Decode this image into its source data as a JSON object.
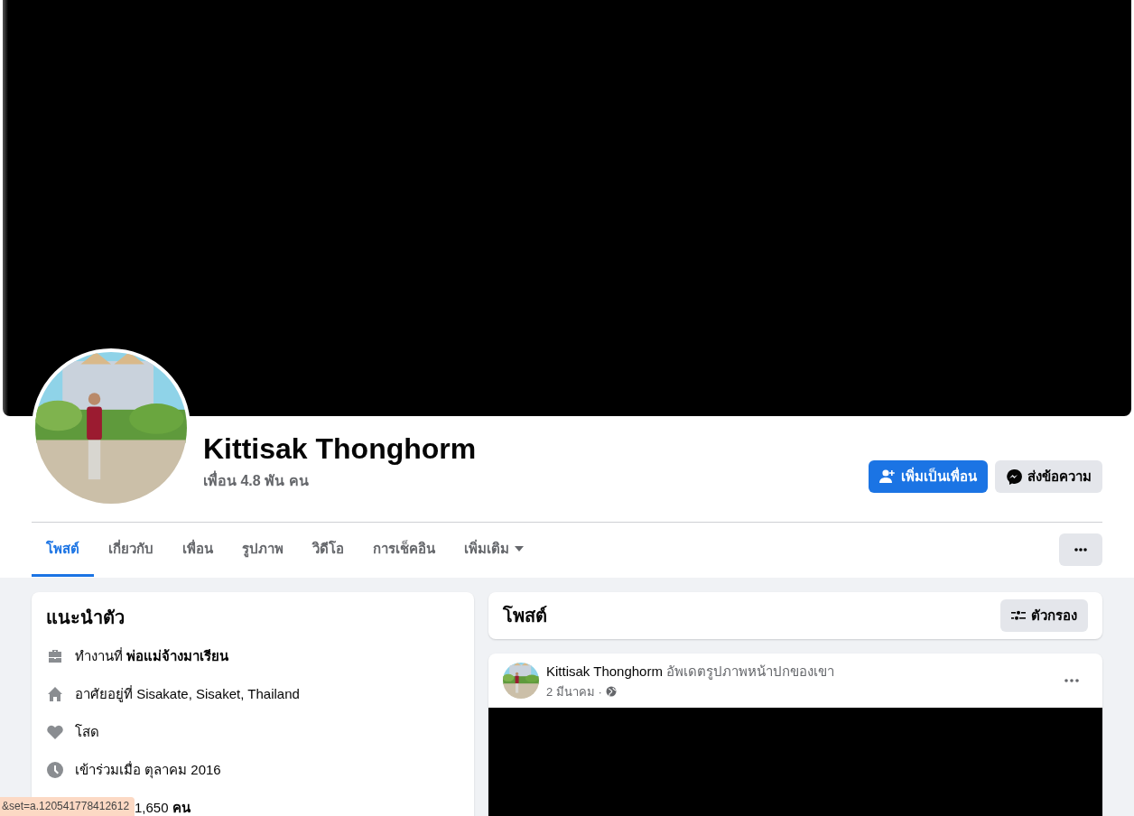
{
  "profile": {
    "name": "Kittisak Thonghorm",
    "friends": "เพื่อน 4.8 พัน คน"
  },
  "actions": [
    {
      "kind": "primary",
      "label": "เพิ่มเป็นเพื่อน"
    },
    {
      "kind": "secondary",
      "label": "ส่งข้อความ"
    }
  ],
  "tabs": [
    {
      "label": "โพสต์",
      "selected": true,
      "dropdown": false
    },
    {
      "label": "เกี่ยวกับ",
      "selected": false,
      "dropdown": false
    },
    {
      "label": "เพื่อน",
      "selected": false,
      "dropdown": false
    },
    {
      "label": "รูปภาพ",
      "selected": false,
      "dropdown": false
    },
    {
      "label": "วิดีโอ",
      "selected": false,
      "dropdown": false
    },
    {
      "label": "การเช็คอิน",
      "selected": false,
      "dropdown": false
    },
    {
      "label": "เพิ่มเติม",
      "selected": false,
      "dropdown": true
    }
  ],
  "intro": {
    "title": "แนะนำตัว",
    "items": [
      {
        "kind": "work",
        "text": "ทำงานที่ **พ่อแม่จ้างมาเรียน**"
      },
      {
        "kind": "home",
        "text": "อาศัยอยู่ที่ Sisakate, Sisaket, Thailand"
      },
      {
        "kind": "relationship",
        "text": "โสด"
      },
      {
        "kind": "joined",
        "text": "เข้าร่วมเมื่อ ตุลาคม 2016"
      },
      {
        "kind": "followers",
        "text": "1,650 **คน**"
      }
    ]
  },
  "posts_header": {
    "title": "โพสต์",
    "filter": "ตัวกรอง"
  },
  "post": {
    "author": "Kittisak Thonghorm",
    "action": "อัพเดตรูปภาพหน้าปกของเขา",
    "date": "2 มีนาคม ·"
  },
  "status_url": "&set=a.120541778412612"
}
